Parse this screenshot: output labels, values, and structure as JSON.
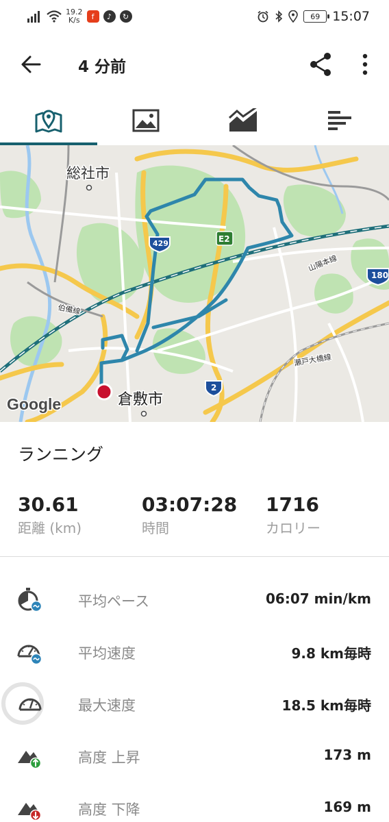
{
  "status_bar": {
    "net_speed_value": "19.2",
    "net_speed_unit": "K/s",
    "battery": "69",
    "time": "15:07",
    "icons": [
      "signal-icon",
      "wifi-icon",
      "flash-app-icon",
      "music-app-icon",
      "sync-app-icon",
      "alarm-icon",
      "bluetooth-icon",
      "location-icon"
    ]
  },
  "app_bar": {
    "title": "4 分前",
    "icons": [
      "back-arrow-icon",
      "share-icon",
      "more-vert-icon"
    ]
  },
  "tabs": [
    {
      "name": "map",
      "icon": "map-pin-icon",
      "selected": true
    },
    {
      "name": "photos",
      "icon": "image-icon",
      "selected": false
    },
    {
      "name": "charts",
      "icon": "area-chart-icon",
      "selected": false
    },
    {
      "name": "laps",
      "icon": "bars-icon",
      "selected": false
    }
  ],
  "map": {
    "labels": {
      "city_soja": "総社市",
      "city_kurashiki": "倉敷市",
      "rail_hakubi": "伯備線",
      "rail_sanyo": "山陽本線",
      "rail_seto": "瀬戸大橋線",
      "route_429": "429",
      "route_e2": "E2",
      "route_180": "180",
      "route_2": "2",
      "attribution": "Google"
    },
    "colors": {
      "track": "#2e86ab",
      "end_marker": "#c8102e",
      "park": "#bde5b0",
      "expressway": "#f5c84c"
    }
  },
  "activity": {
    "type": "ランニング",
    "stats": [
      {
        "value": "30.61",
        "label": "距離 (km)"
      },
      {
        "value": "03:07:28",
        "label": "時間"
      },
      {
        "value": "1716",
        "label": "カロリー"
      }
    ]
  },
  "metrics": [
    {
      "icon": "pace-stopwatch-icon",
      "label": "平均ペース",
      "value": "06:07 min/km"
    },
    {
      "icon": "average-speed-gauge-icon",
      "label": "平均速度",
      "value": "9.8 km毎時"
    },
    {
      "icon": "max-speed-gauge-icon",
      "label": "最大速度",
      "value": "18.5 km毎時"
    },
    {
      "icon": "elevation-gain-icon",
      "label": "高度 上昇",
      "value": "173 m"
    },
    {
      "icon": "elevation-loss-icon",
      "label": "高度 下降",
      "value": "169 m"
    }
  ]
}
